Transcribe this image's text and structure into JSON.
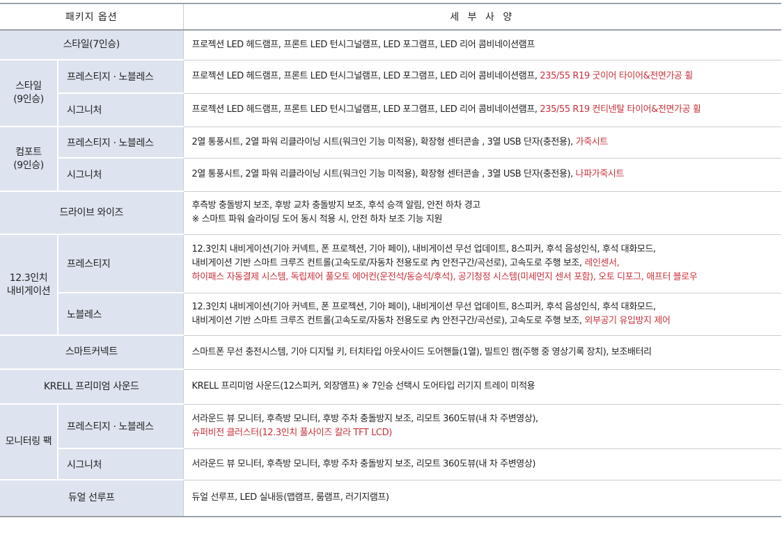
{
  "header": {
    "col_package": "패키지 옵션",
    "col_spec": "세 부 사 양"
  },
  "rows": {
    "style7": {
      "category": "스타일(7인승)",
      "desc": "프로젝션 LED 헤드램프, 프론트 LED 턴시그널램프, LED 포그램프, LED 리어 콤비네이션램프"
    },
    "style9": {
      "category_l1": "스타일",
      "category_l2": "(9인승)",
      "prestige_noblesse": {
        "label": "프레스티지 · 노블레스",
        "desc": "프로젝션 LED 헤드램프, 프론트 LED 턴시그널램프, LED 포그램프, LED 리어 콤비네이션램프, ",
        "desc_red": "235/55 R19 굿이어 타이어&전면가공 휠"
      },
      "signature": {
        "label": "시그니처",
        "desc": "프로젝션 LED 헤드램프, 프론트 LED 턴시그널램프, LED 포그램프, LED 리어 콤비네이션램프, ",
        "desc_red": "235/55 R19 컨티넨탈 타이어&전면가공 휠"
      }
    },
    "comfort9": {
      "category_l1": "컴포트",
      "category_l2": "(9인승)",
      "prestige_noblesse": {
        "label": "프레스티지 · 노블레스",
        "desc": "2열 통풍시트, 2열 파워 리클라이닝 시트(워크인 기능 미적용), 확장형 센터콘솔 , 3열 USB 단자(충전용), ",
        "desc_red": "가죽시트"
      },
      "signature": {
        "label": "시그니처",
        "desc": "2열 통풍시트, 2열 파워 리클라이닝 시트(워크인 기능 미적용), 확장형 센터콘솔 , 3열 USB 단자(충전용), ",
        "desc_red": "나파가죽시트"
      }
    },
    "drivewise": {
      "category": "드라이브 와이즈",
      "desc_l1": "후측방 충돌방지 보조, 후방 교차 충돌방지 보조, 후석 승객 알림, 안전 하차 경고",
      "desc_l2": "※ 스마트 파워 슬라이딩 도어 동시 적용 시, 안전 하차 보조 기능 지원"
    },
    "navi": {
      "category_l1": "12.3인치",
      "category_l2": "내비게이션",
      "prestige": {
        "label": "프레스티지",
        "desc_l1": "12.3인치 내비게이션(기아 커넥트, 폰 프로젝션, 기아 페이), 내비게이션 무선 업데이트, 8스피커, 후석 음성인식, 후석 대화모드,",
        "desc_l2": "내비게이션 기반 스마트 크루즈 컨트롤(고속도로/자동차 전용도로 內 안전구간/곡선로), 고속도로 주행 보조, ",
        "desc_l2_red": "레인센서,",
        "desc_l3_red": "하이패스 자동결제 시스템, 독립제어 풀오토 에어컨(운전석/동승석/후석), 공기청정 시스템(미세먼지 센서 포함), 오토 디포그, 애프터 블로우"
      },
      "noblesse": {
        "label": "노블레스",
        "desc_l1": "12.3인치 내비게이션(기아 커넥트, 폰 프로젝션, 기아 페이), 내비게이션 무선 업데이트, 8스피커, 후석 음성인식, 후석 대화모드,",
        "desc_l2": "내비게이션 기반 스마트 크루즈 컨트롤(고속도로/자동차 전용도로 內 안전구간/곡선로), 고속도로 주행 보조, ",
        "desc_l2_red": "외부공기 유입방지 제어"
      }
    },
    "smartconnect": {
      "category": "스마트커넥트",
      "desc": "스마트폰 무선 충전시스템, 기아 디지털 키, 터치타입 아웃사이드 도어핸들(1열), 빌트인 캠(주행 중 영상기록 장치), 보조배터리"
    },
    "krell": {
      "category": "KRELL 프리미엄 사운드",
      "desc": "KRELL 프리미엄 사운드(12스피커, 외장앰프)  ※ 7인승 선택시 도어타입 러기지 트레이 미적용"
    },
    "monitoring": {
      "category": "모니터링 팩",
      "prestige_noblesse": {
        "label": "프레스티지 · 노블레스",
        "desc_l1": "서라운드 뷰 모니터, 후측방 모니터, 후방 주차 충돌방지 보조, 리모트 360도뷰(내 차 주변영상),",
        "desc_l2_red": "슈퍼비전 클러스터(12.3인치 풀사이즈 칼라 TFT LCD)"
      },
      "signature": {
        "label": "시그니처",
        "desc": "서라운드 뷰 모니터, 후측방 모니터, 후방 주차 충돌방지 보조, 리모트 360도뷰(내 차 주변영상)"
      }
    },
    "dualsunroof": {
      "category": "듀얼 선루프",
      "desc": "듀얼 선루프, LED 실내등(맵램프, 룸램프, 러기지램프)"
    }
  },
  "colors": {
    "header_bg": "#ffffff",
    "label_bg": "#dde4ef",
    "highlight_red": "#c8323c",
    "border": "#9aa1a8"
  }
}
